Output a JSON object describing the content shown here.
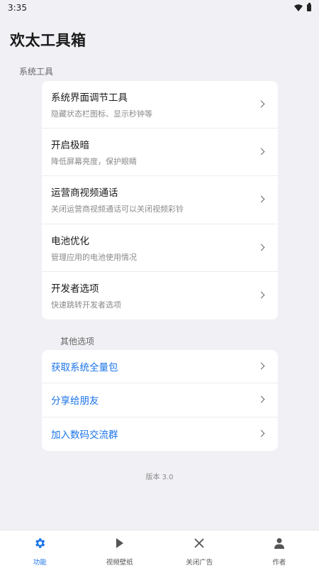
{
  "status_bar": {
    "time": "3:35"
  },
  "page_title": "欢太工具箱",
  "sections": [
    {
      "label": "系统工具"
    },
    {
      "label": "其他选项"
    }
  ],
  "system_tools": [
    {
      "title": "系统界面调节工具",
      "subtitle": "隐藏状态栏图标、显示秒钟等"
    },
    {
      "title": "开启极暗",
      "subtitle": "降低屏幕亮度，保护眼睛"
    },
    {
      "title": "运营商视频通话",
      "subtitle": "关闭运营商视频通话可以关闭视频彩铃"
    },
    {
      "title": "电池优化",
      "subtitle": "管理应用的电池使用情况"
    },
    {
      "title": "开发者选项",
      "subtitle": "快速跳转开发者选项"
    }
  ],
  "other_options": [
    {
      "title": "获取系统全量包"
    },
    {
      "title": "分享给朋友"
    },
    {
      "title": "加入数码交流群"
    }
  ],
  "version": "版本 3.0",
  "bottom_nav": [
    {
      "label": "功能",
      "icon": "gear-icon",
      "active": true
    },
    {
      "label": "视频壁纸",
      "icon": "play-icon",
      "active": false
    },
    {
      "label": "关闭广告",
      "icon": "close-icon",
      "active": false
    },
    {
      "label": "作者",
      "icon": "person-icon",
      "active": false
    }
  ],
  "colors": {
    "accent": "#1a73e8",
    "background": "#f1f1f5",
    "card": "#ffffff"
  }
}
